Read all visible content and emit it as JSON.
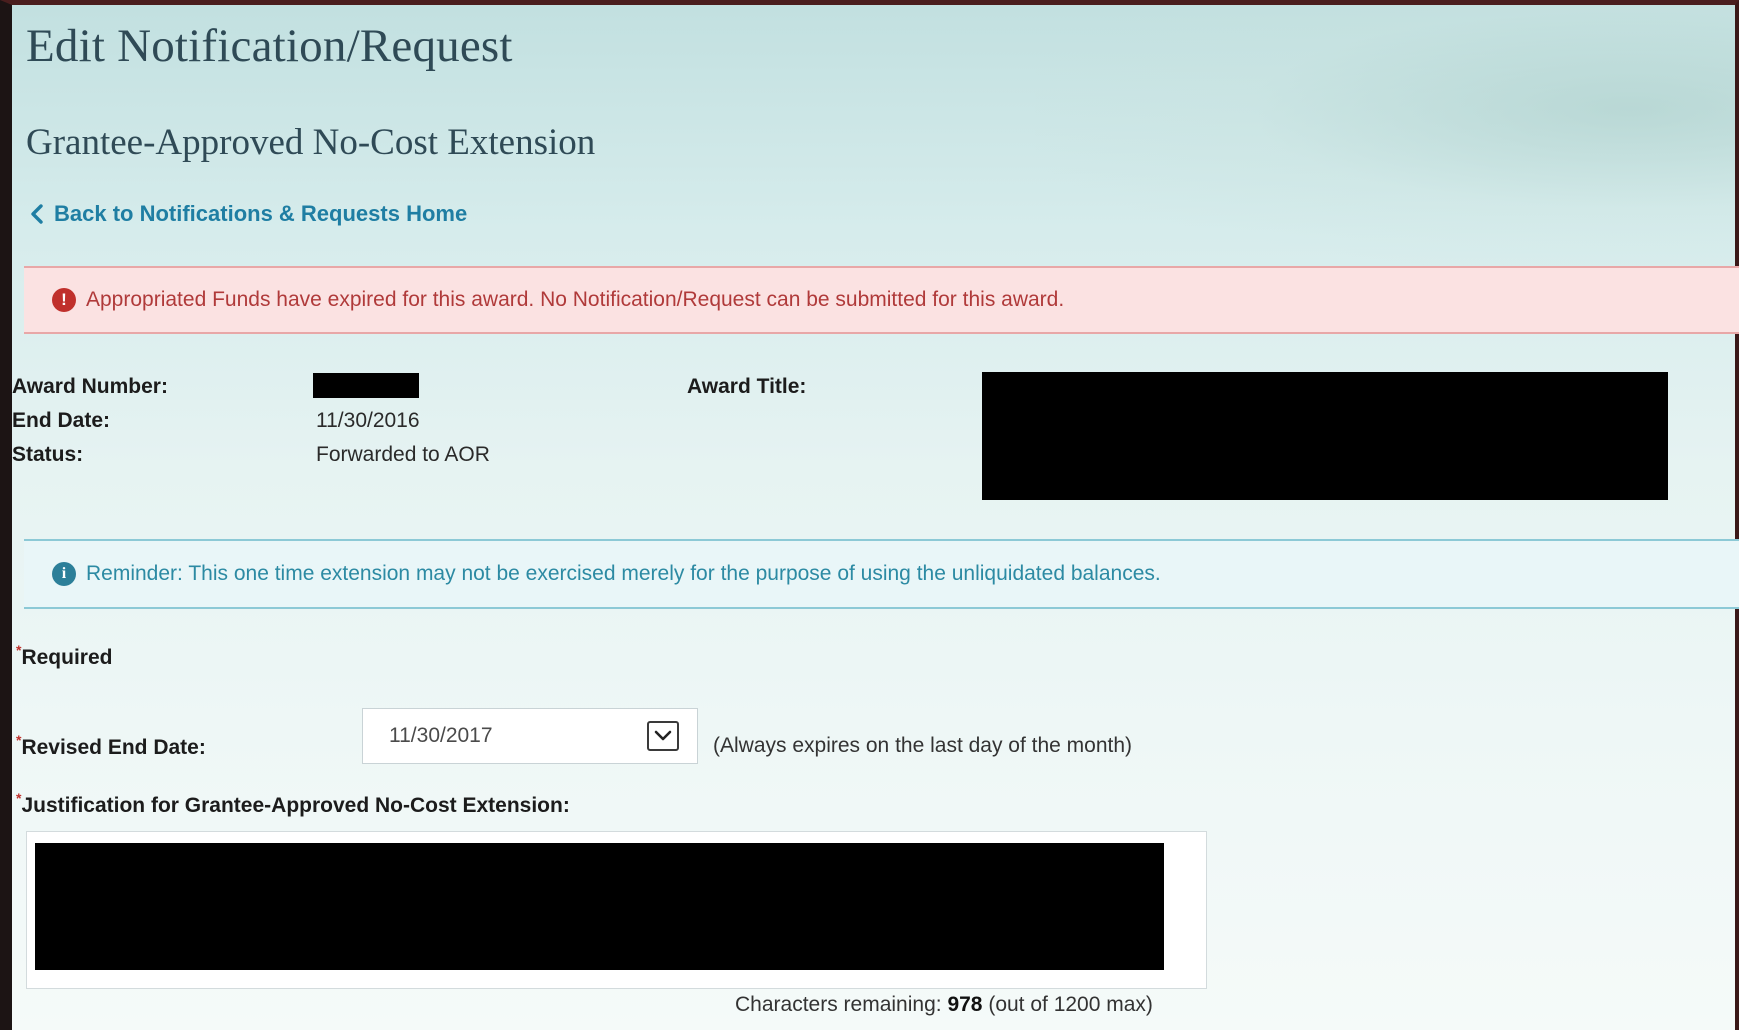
{
  "header": {
    "title": "Edit Notification/Request",
    "subtitle": "Grantee-Approved No-Cost Extension",
    "back_link": "Back to Notifications & Requests Home"
  },
  "alert": {
    "icon": "exclamation-circle-icon",
    "icon_glyph": "!",
    "color": "#c0302c",
    "text": "Appropriated Funds have expired for this award. No Notification/Request can be submitted for this award."
  },
  "award": {
    "number_label": "Award Number:",
    "number_value": "[redacted]",
    "end_date_label": "End Date:",
    "end_date_value": "11/30/2016",
    "status_label": "Status:",
    "status_value": "Forwarded to AOR",
    "title_label": "Award Title:",
    "title_value": "[redacted]"
  },
  "reminder": {
    "icon": "info-circle-icon",
    "icon_glyph": "i",
    "color": "#2c8aa3",
    "text": "Reminder: This one time extension may not be exercised merely for the purpose of using the unliquidated balances."
  },
  "form": {
    "required_note": "Required",
    "revised_end_date_label": "Revised End Date:",
    "revised_end_date_value": "11/30/2017",
    "revised_end_date_hint": "(Always expires on the last day of the month)",
    "justification_label": "Justification for Grantee-Approved No-Cost Extension:",
    "justification_value": "[redacted]",
    "chars_prefix": "Characters remaining:",
    "chars_remaining": "978",
    "chars_suffix": "(out of 1200 max)"
  },
  "colors": {
    "title": "#2f4a56",
    "link": "#1f7ea3",
    "alert_bg": "#fbe2e2",
    "info_bg": "#e9f6f8"
  }
}
